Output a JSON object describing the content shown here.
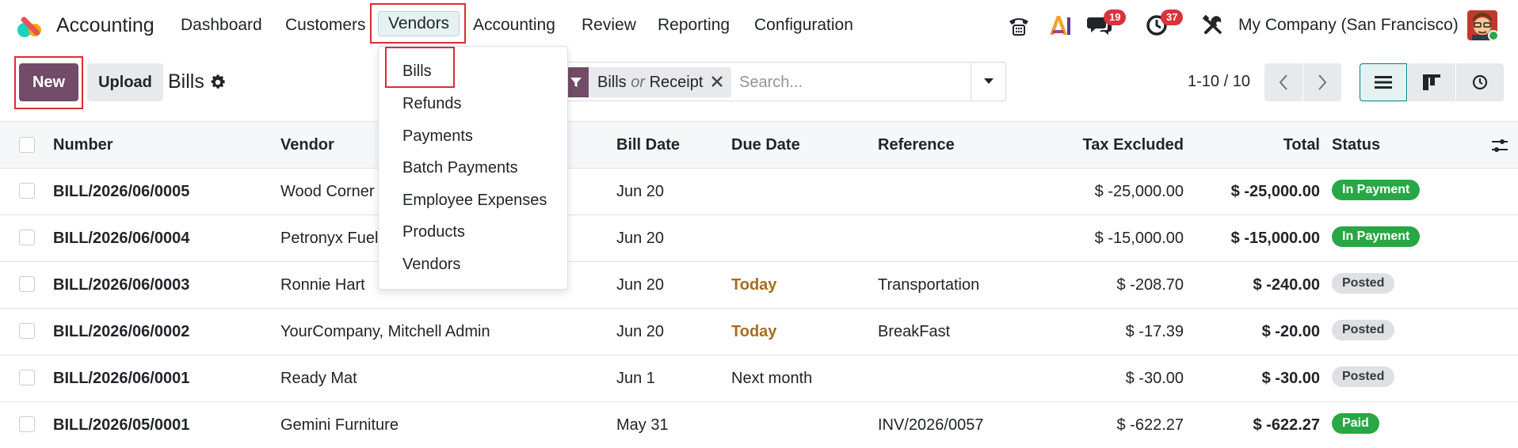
{
  "navbar": {
    "app_name": "Accounting",
    "menus": [
      "Dashboard",
      "Customers",
      "Vendors",
      "Accounting",
      "Review",
      "Configuration",
      "Reporting"
    ],
    "active_menu": "Vendors",
    "badge_messages": "19",
    "badge_activities": "37",
    "company": "My Company (San Francisco)"
  },
  "control_panel": {
    "new_label": "New",
    "upload_label": "Upload",
    "title": "Bills",
    "search": {
      "facet_left": "Bills",
      "facet_or": "or",
      "facet_right": "Receipt",
      "placeholder": "Search..."
    },
    "pager": "1-10 / 10"
  },
  "dropdown": {
    "items": [
      "Bills",
      "Refunds",
      "Payments",
      "Batch Payments",
      "Employee Expenses",
      "Products",
      "Vendors"
    ]
  },
  "table": {
    "headers": {
      "number": "Number",
      "vendor": "Vendor",
      "bill_date": "Bill Date",
      "due_date": "Due Date",
      "reference": "Reference",
      "tax_excluded": "Tax Excluded",
      "total": "Total",
      "status": "Status"
    },
    "rows": [
      {
        "number": "BILL/2026/06/0005",
        "vendor": "Wood Corner",
        "bill_date": "Jun 20",
        "due_date": "",
        "reference": "",
        "tax_excluded": "$ -25,000.00",
        "total": "$ -25,000.00",
        "status": "In Payment"
      },
      {
        "number": "BILL/2026/06/0004",
        "vendor": "Petronyx Fuel",
        "bill_date": "Jun 20",
        "due_date": "",
        "reference": "",
        "tax_excluded": "$ -15,000.00",
        "total": "$ -15,000.00",
        "status": "In Payment"
      },
      {
        "number": "BILL/2026/06/0003",
        "vendor": "Ronnie Hart",
        "bill_date": "Jun 20",
        "due_date": "Today",
        "reference": "Transportation",
        "tax_excluded": "$ -208.70",
        "total": "$ -240.00",
        "status": "Posted"
      },
      {
        "number": "BILL/2026/06/0002",
        "vendor": "YourCompany, Mitchell Admin",
        "bill_date": "Jun 20",
        "due_date": "Today",
        "reference": "BreakFast",
        "tax_excluded": "$ -17.39",
        "total": "$ -20.00",
        "status": "Posted"
      },
      {
        "number": "BILL/2026/06/0001",
        "vendor": "Ready Mat",
        "bill_date": "Jun 1",
        "due_date": "Next month",
        "reference": "",
        "tax_excluded": "$ -30.00",
        "total": "$ -30.00",
        "status": "Posted"
      },
      {
        "number": "BILL/2026/05/0001",
        "vendor": "Gemini Furniture",
        "bill_date": "May 31",
        "due_date": "",
        "reference": "INV/2026/0057",
        "tax_excluded": "$ -622.27",
        "total": "$ -622.27",
        "status": "Paid"
      }
    ]
  },
  "colors": {
    "brand": "#714b67",
    "accent": "#017e84",
    "highlight": "#dc2d32",
    "status_green": "#28a745",
    "due_today": "#a86d1f"
  },
  "icons": [
    "app-logo-icon",
    "phone-icon",
    "ai-icon",
    "chat-icon",
    "clock-icon",
    "tools-icon",
    "gear-icon",
    "filter-icon",
    "close-icon",
    "caret-down-icon",
    "chevron-left-icon",
    "chevron-right-icon",
    "list-view-icon",
    "kanban-view-icon",
    "activity-view-icon",
    "column-settings-icon"
  ]
}
